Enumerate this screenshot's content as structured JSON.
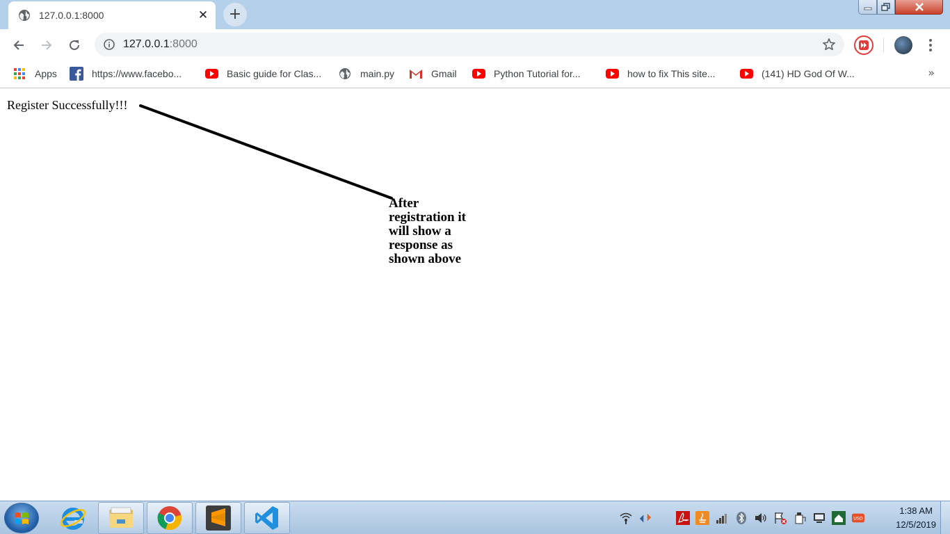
{
  "browser": {
    "tab": {
      "title": "127.0.0.1:8000",
      "icon": "globe-icon",
      "close_glyph": "✕"
    },
    "new_tab_glyph": "+",
    "address": {
      "host": "127.0.0.1",
      "port": ":8000"
    },
    "bookmarks": [
      {
        "label": "Apps",
        "icon": "apps-grid-icon"
      },
      {
        "label": "https://www.facebo...",
        "icon": "facebook-icon"
      },
      {
        "label": "Basic guide for Clas...",
        "icon": "youtube-icon"
      },
      {
        "label": "main.py",
        "icon": "globe-icon"
      },
      {
        "label": "Gmail",
        "icon": "gmail-icon"
      },
      {
        "label": "Python Tutorial for...",
        "icon": "youtube-icon"
      },
      {
        "label": "how to fix This site...",
        "icon": "youtube-icon"
      },
      {
        "label": "(141) HD God Of W...",
        "icon": "youtube-icon"
      }
    ],
    "bookmarks_overflow": "»"
  },
  "page": {
    "message": "Register Successfully!!!",
    "annotation": "After registration it will show a response as shown above"
  },
  "taskbar": {
    "clock_time": "1:38 AM",
    "clock_date": "12/5/2019",
    "apps": [
      "ie-icon",
      "file-explorer-icon",
      "chrome-icon",
      "sublime-text-icon",
      "vscode-icon"
    ]
  },
  "colors": {
    "titlebar": "#b5d0ea",
    "youtube": "#ff0000",
    "facebook": "#3b5998",
    "chrome_red": "#db4437",
    "chrome_yellow": "#f4b400",
    "chrome_green": "#0f9d58",
    "chrome_blue": "#4285f4"
  }
}
